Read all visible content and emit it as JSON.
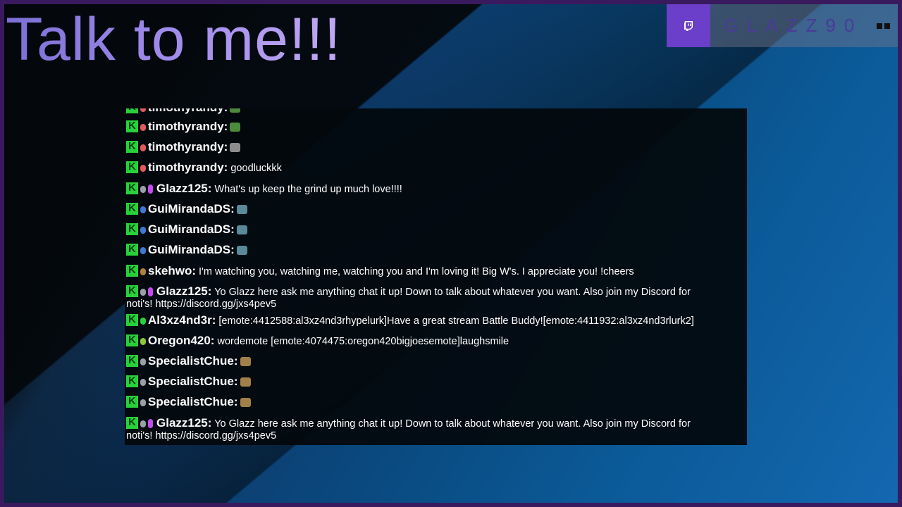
{
  "overlay": {
    "title": "Talk to me!!!",
    "brand_name": "GLAZZ90"
  },
  "chat": {
    "messages": [
      {
        "user": "timothyrandy:",
        "text": "",
        "badge_color": "#e25a5a",
        "emote_color": "#4c8a3c"
      },
      {
        "user": "timothyrandy:",
        "text": "",
        "badge_color": "#e25a5a",
        "emote_color": "#4c8a3c"
      },
      {
        "user": "timothyrandy:",
        "text": "",
        "badge_color": "#e25a5a",
        "emote_color": "#8d8d8d"
      },
      {
        "user": "timothyrandy:",
        "text": "goodluckkk",
        "badge_color": "#e25a5a"
      },
      {
        "user": "Glazz125:",
        "text": "What's up keep the grind up much love!!!!",
        "badge_color": "#9aa0a8"
      },
      {
        "user": "GuiMirandaDS:",
        "text": "",
        "badge_color": "#3c7ad6",
        "emote_color": "#5a8a9a"
      },
      {
        "user": "GuiMirandaDS:",
        "text": "",
        "badge_color": "#3c7ad6",
        "emote_color": "#5a8a9a"
      },
      {
        "user": "GuiMirandaDS:",
        "text": "",
        "badge_color": "#3c7ad6",
        "emote_color": "#5a8a9a"
      },
      {
        "user": "skehwo:",
        "text": "I'm watching you, watching me, watching you and I'm loving it! Big W's. I appreciate you! !cheers",
        "badge_color": "#b08040"
      },
      {
        "user": "Glazz125:",
        "text": "Yo Glazz here ask me anything chat it up! Down to talk about whatever you want. Also join my Discord for",
        "text2": "noti's! https://discord.gg/jxs4pev5",
        "badge_color": "#9aa0a8"
      },
      {
        "user": "Al3xz4nd3r:",
        "text": "[emote:4412588:al3xz4nd3rhypelurk]Have a great stream Battle Buddy![emote:4411932:al3xz4nd3rlurk2]",
        "badge_color": "#27d13a"
      },
      {
        "user": "Oregon420:",
        "text": "wordemote [emote:4074475:oregon420bigjoesemote]laughsmile",
        "badge_color": "#8cc83c"
      },
      {
        "user": "SpecialistChue:",
        "text": "",
        "badge_color": "#9aa0a8",
        "emote_color": "#a08048"
      },
      {
        "user": "SpecialistChue:",
        "text": "",
        "badge_color": "#9aa0a8",
        "emote_color": "#a08048"
      },
      {
        "user": "SpecialistChue:",
        "text": "",
        "badge_color": "#9aa0a8",
        "emote_color": "#a08048"
      },
      {
        "user": "Glazz125:",
        "text": "Yo Glazz here ask me anything chat it up! Down to talk about whatever you want. Also join my Discord for",
        "text2": "noti's! https://discord.gg/jxs4pev5",
        "badge_color": "#9aa0a8"
      }
    ]
  },
  "colors": {
    "accent_purple": "#6b3fc9",
    "kick_green": "#27d13a",
    "mic_purple": "#c44cf0"
  }
}
